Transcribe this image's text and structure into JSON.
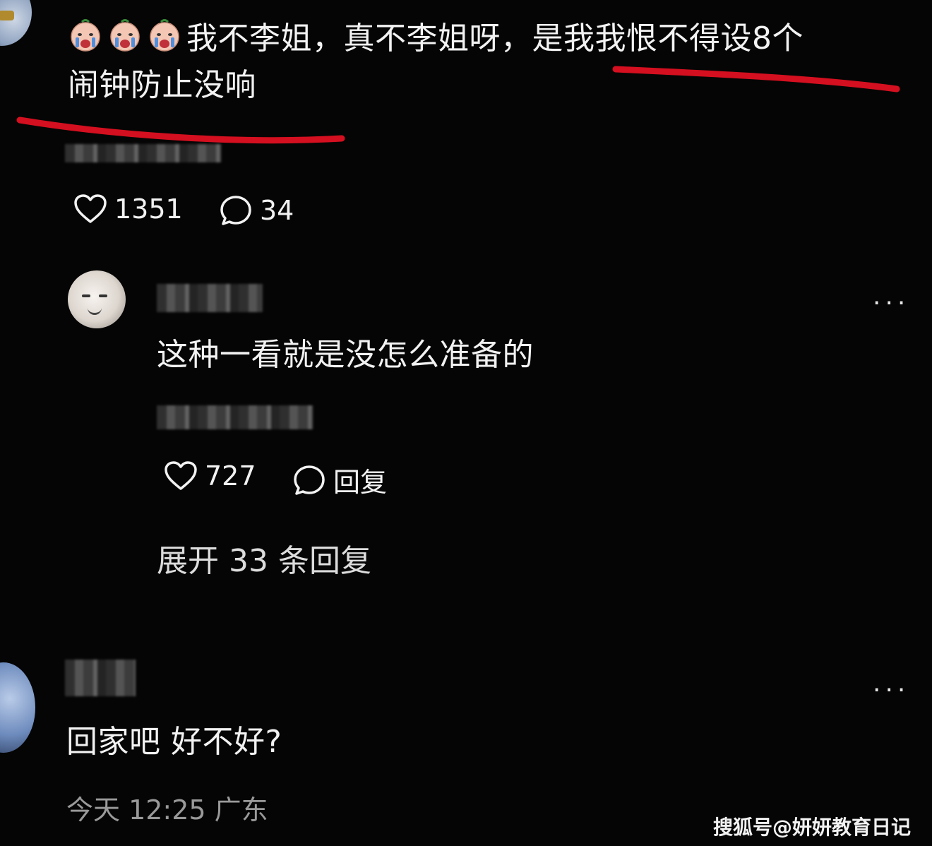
{
  "top_comment": {
    "text_line1": "我不李姐，真不李姐呀，是我我恨不得设8个",
    "text_line2": "闹钟防止没响",
    "emoji_icon": "crying-face-emoji",
    "likes": "1351",
    "comments": "34"
  },
  "reply": {
    "text": "这种一看就是没怎么准备的",
    "likes": "727",
    "reply_label": "回复",
    "expand_label": "展开 33 条回复",
    "more_label": "..."
  },
  "third_comment": {
    "text": "回家吧 好不好?",
    "meta": "今天 12:25 广东",
    "more_label": "..."
  },
  "watermark": "搜狐号@妍妍教育日记",
  "annotation_color": "#d40f1f"
}
